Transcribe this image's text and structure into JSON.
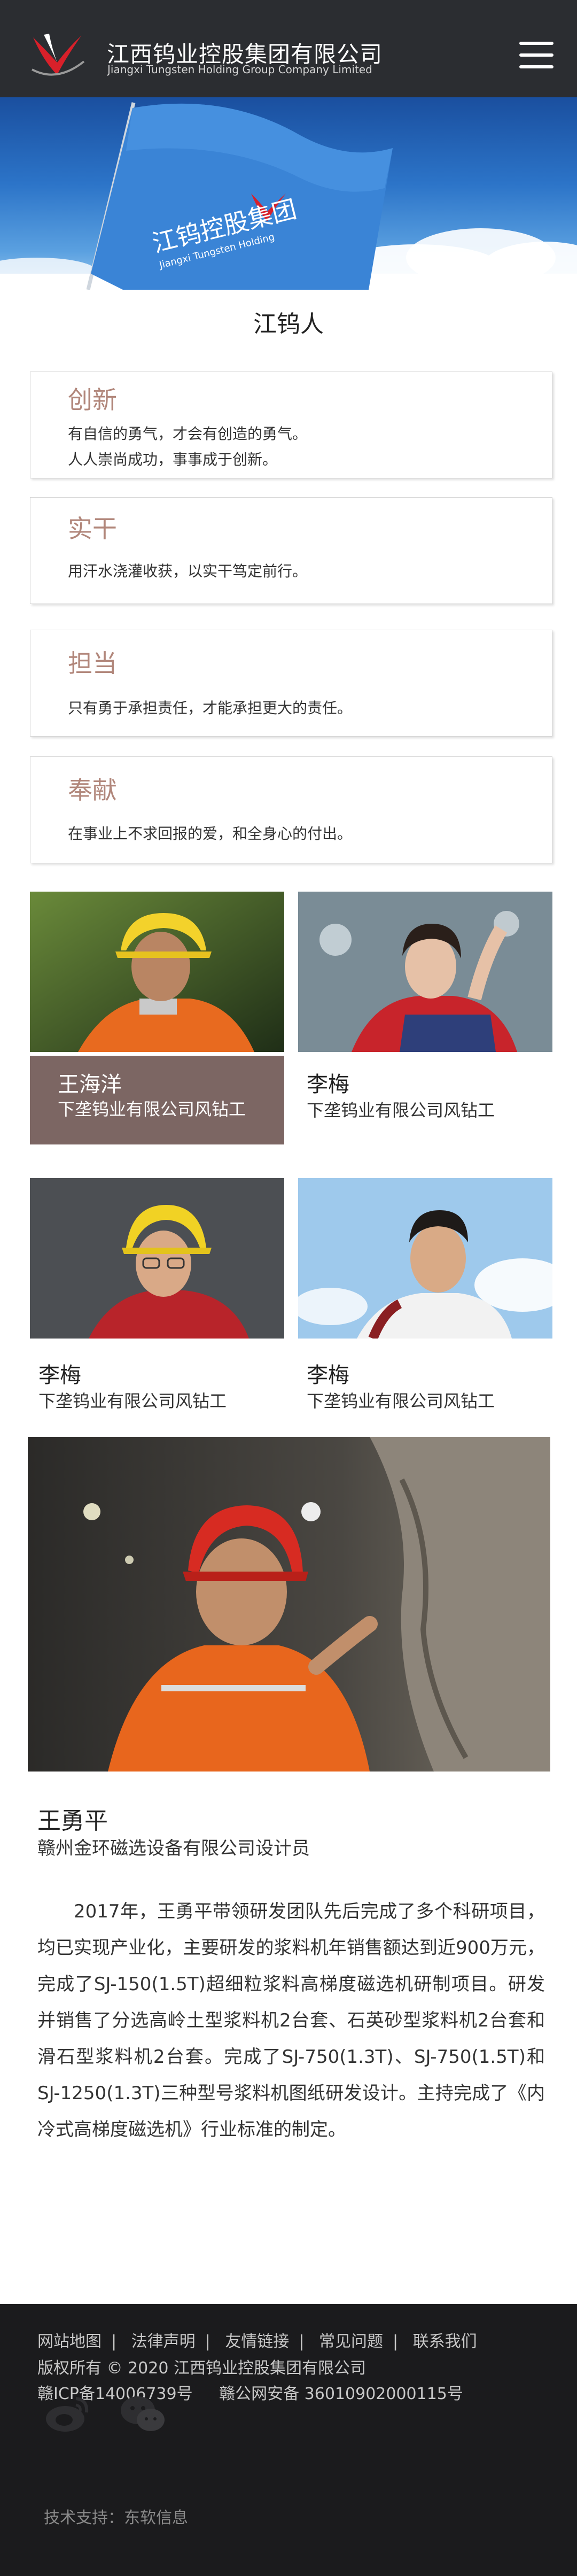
{
  "header": {
    "company_cn": "江西钨业控股集团有限公司",
    "company_en": "Jiangxi Tungsten Holding Group Company Limited",
    "logo_icon": "jw-logo-icon",
    "menu_icon": "hamburger-menu-icon"
  },
  "banner": {
    "flag_text": "江钨控股集团",
    "flag_subtext": "Jiangxi Tungsten Holding"
  },
  "page_title": "江钨人",
  "values": [
    {
      "title": "创新",
      "lines": [
        "有自信的勇气，才会有创造的勇气。",
        "人人崇尚成功，事事成于创新。"
      ]
    },
    {
      "title": "实干",
      "lines": [
        "用汗水浇灌收获，以实干笃定前行。"
      ]
    },
    {
      "title": "担当",
      "lines": [
        "只有勇于承担责任，才能承担更大的责任。"
      ]
    },
    {
      "title": "奉献",
      "lines": [
        "在事业上不求回报的爱，和全身心的付出。"
      ]
    }
  ],
  "people": [
    {
      "name": "王海洋",
      "role": "下垄钨业有限公司风钻工"
    },
    {
      "name": "李梅",
      "role": "下垄钨业有限公司风钻工"
    },
    {
      "name": "李梅",
      "role": "下垄钨业有限公司风钻工"
    },
    {
      "name": "李梅",
      "role": "下垄钨业有限公司风钻工"
    }
  ],
  "feature": {
    "name": "王勇平",
    "role": "赣州金环磁选设备有限公司设计员",
    "article": "2017年，王勇平带领研发团队先后完成了多个科研项目，均已实现产业化，主要研发的浆料机年销售额达到近900万元，完成了SJ-150(1.5T)超细粒浆料高梯度磁选机研制项目。研发并销售了分选高岭土型浆料机2台套、石英砂型浆料机2台套和滑石型浆料机2台套。完成了SJ-750(1.3T)、SJ-750(1.5T)和SJ-1250(1.3T)三种型号浆料机图纸研发设计。主持完成了《内冷式高梯度磁选机》行业标准的制定。"
  },
  "footer": {
    "links": [
      "网站地图",
      "法律声明",
      "友情链接",
      "常见问题",
      "联系我们"
    ],
    "copyright": "版权所有 © 2020 江西钨业控股集团有限公司",
    "icp": "赣ICP备14006739号",
    "police": "赣公网安备 36010902000115号",
    "support": "技术支持：东软信息",
    "social_icons": [
      "weibo-icon",
      "wechat-icon"
    ]
  },
  "colors": {
    "header_bg": "#2b2d31",
    "accent_title": "#b1867a",
    "caption_bg": "#7c6663",
    "footer_bg": "#1b1b1d",
    "brand_red": "#d8202a"
  }
}
